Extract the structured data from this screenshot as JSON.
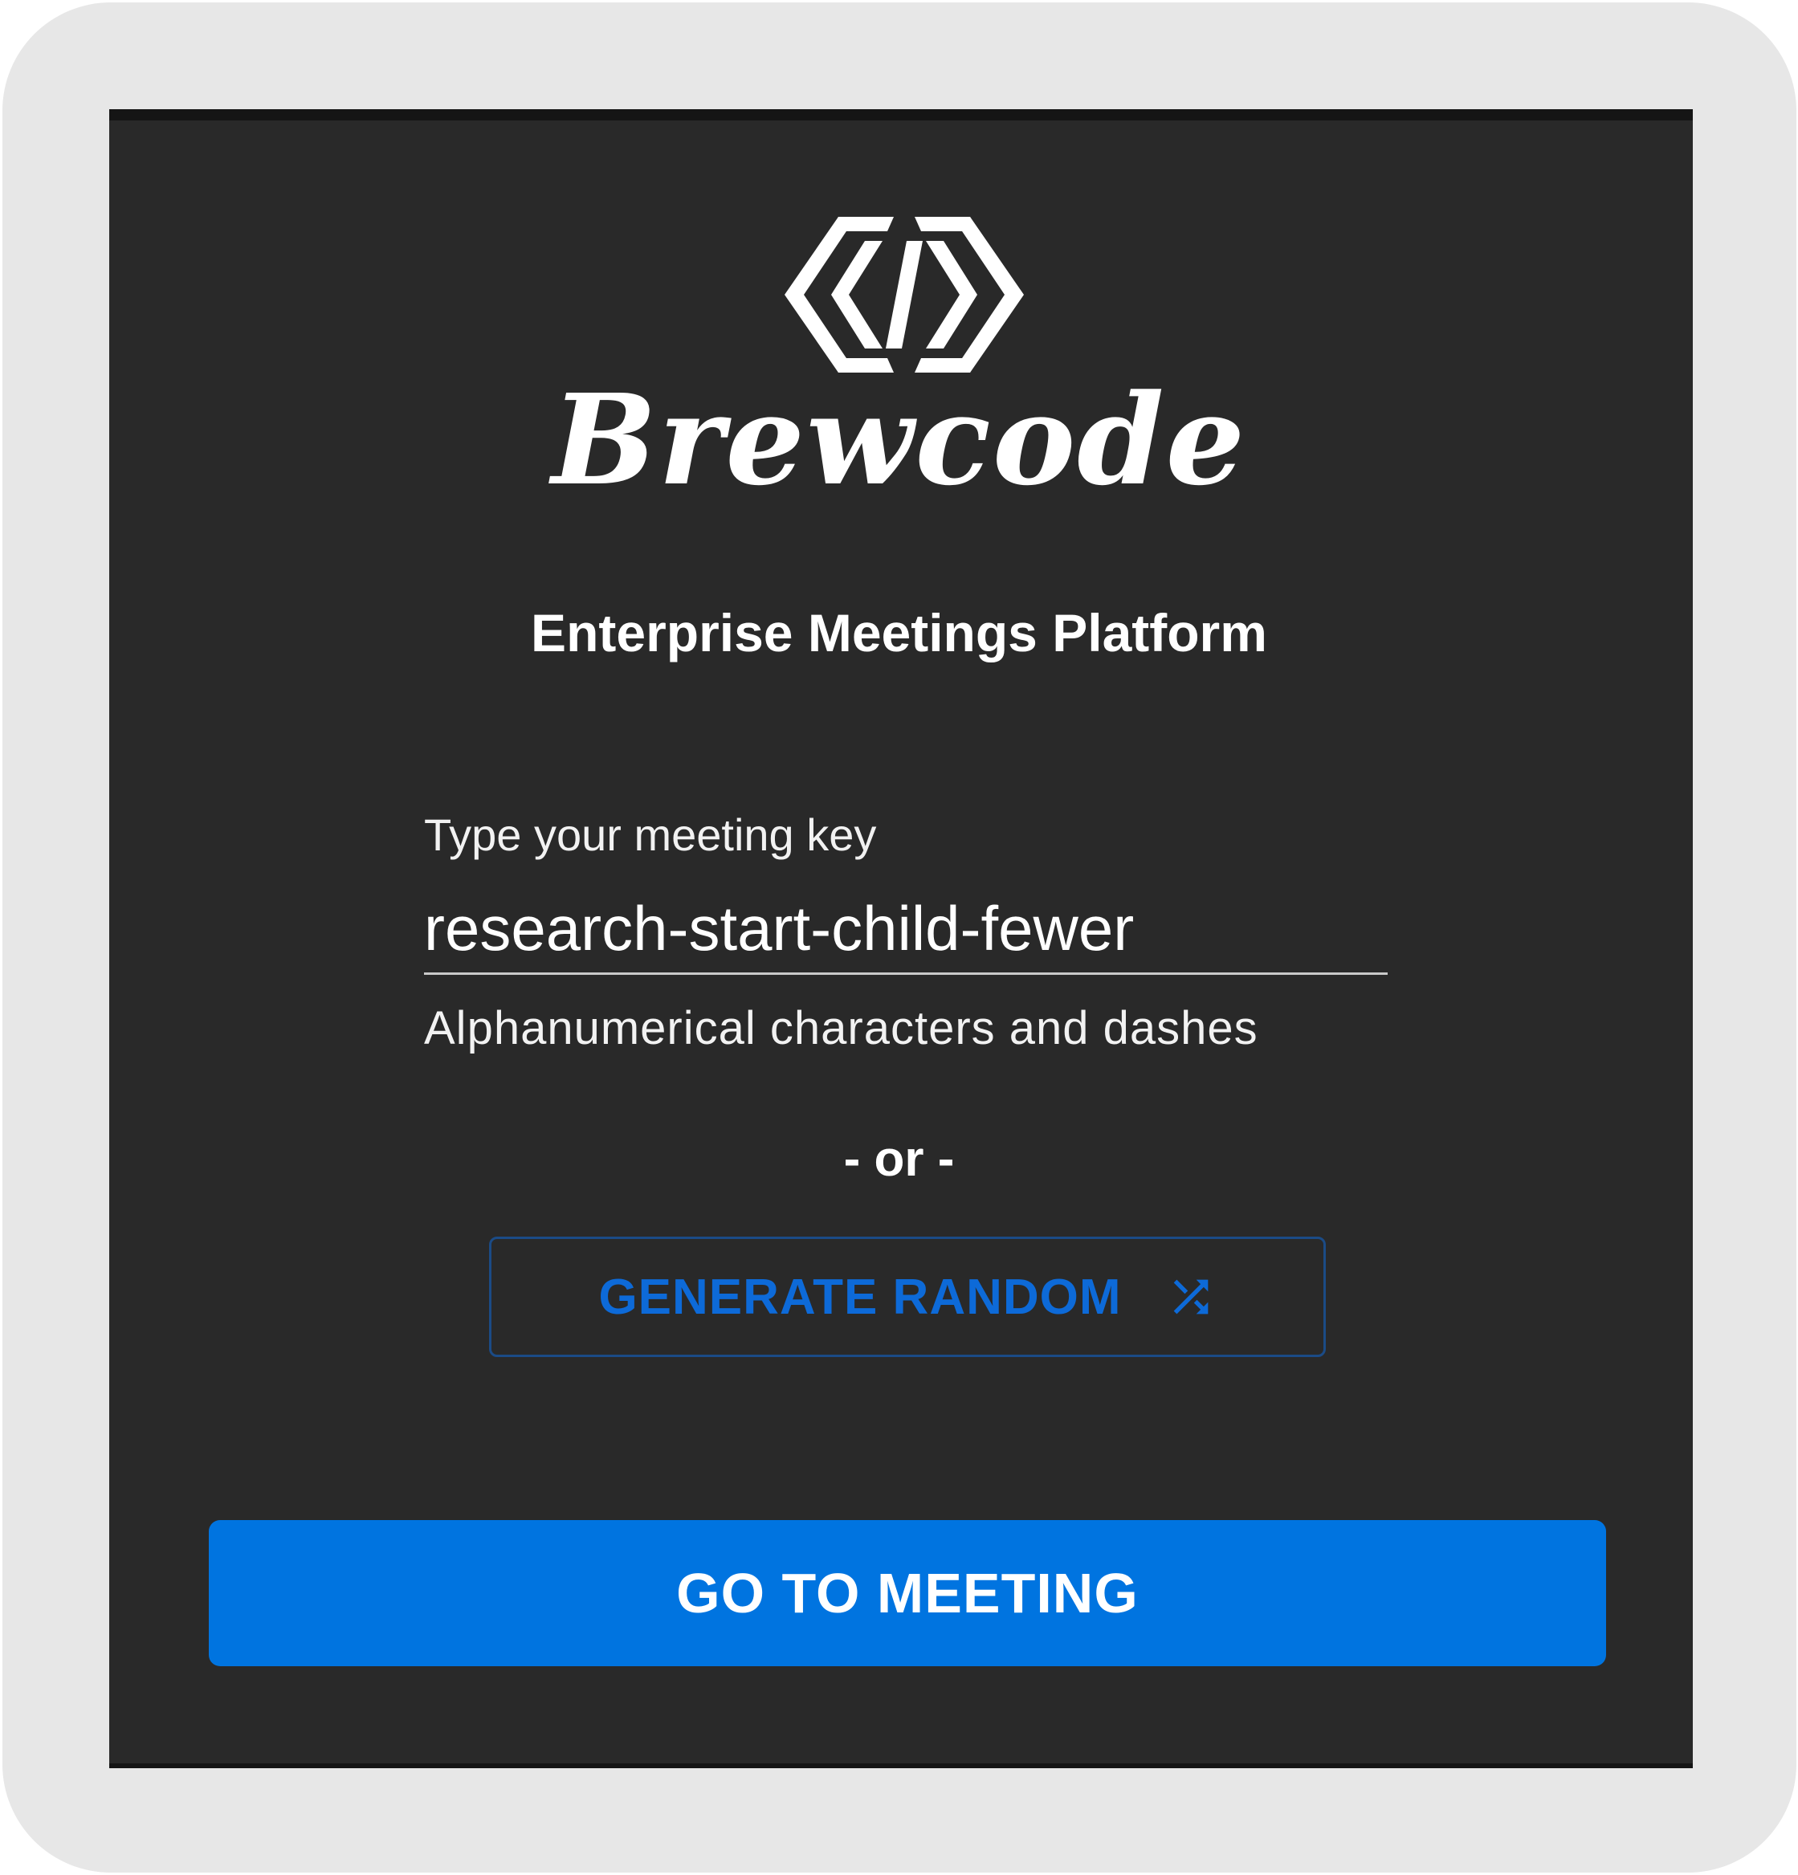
{
  "brand": {
    "name": "Brewcode",
    "logo_icon": "code-hexagon-icon",
    "tagline": "Enterprise Meetings Platform"
  },
  "meeting_key": {
    "label": "Type your meeting key",
    "value": "research-start-child-fewer",
    "hint": "Alphanumerical characters and dashes"
  },
  "separator": "- or -",
  "generate_button": {
    "label": "GENERATE RANDOM",
    "icon": "shuffle-icon"
  },
  "go_button": {
    "label": "GO TO MEETING"
  },
  "colors": {
    "card_background": "#292929",
    "accent_blue": "#0074e0",
    "outline_blue": "#0d6ad8",
    "frame": "#e7e7e7"
  }
}
